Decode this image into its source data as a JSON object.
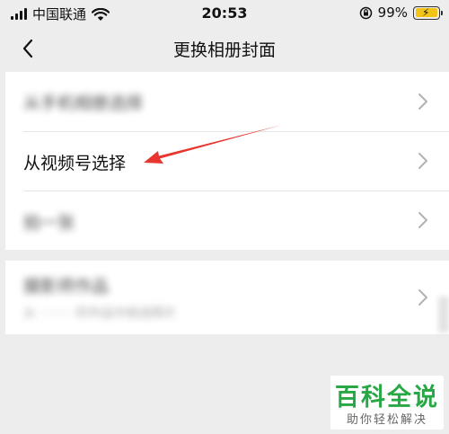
{
  "status_bar": {
    "carrier": "中国联通",
    "time": "20:53",
    "battery_percent": "99%",
    "battery_level": 0.99,
    "battery_color": "#f2c418"
  },
  "nav": {
    "title": "更换相册封面",
    "back_icon": "chevron-left-icon"
  },
  "options": [
    {
      "label": "从手机相册选择",
      "blurred": true
    },
    {
      "label": "从视频号选择",
      "blurred": false
    },
    {
      "label": "拍一张",
      "blurred": true
    }
  ],
  "option_group_2": {
    "label": "摄影师作品",
    "sub_label": "从 ········ 的作品中挑选照片",
    "blurred": true
  },
  "annotation": {
    "arrow_color": "#e8352f"
  },
  "watermark": {
    "title": "百科全说",
    "subtitle": "助你轻松解决",
    "color": "#27a844"
  }
}
